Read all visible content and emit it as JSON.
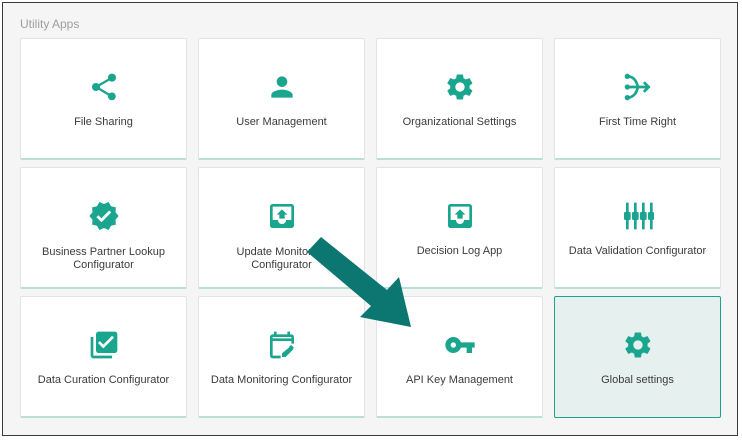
{
  "section": {
    "title": "Utility Apps"
  },
  "colors": {
    "accent": "#1aa58e",
    "arrow": "#0c7671",
    "selected_bg": "#e6f1ef"
  },
  "tiles": [
    {
      "label": "File Sharing",
      "icon": "share-icon"
    },
    {
      "label": "User Management",
      "icon": "person-icon"
    },
    {
      "label": "Organizational Settings",
      "icon": "gear-icon"
    },
    {
      "label": "First Time Right",
      "icon": "split-arrows-icon"
    },
    {
      "label": "Business Partner Lookup Configurator",
      "icon": "verified-badge-icon"
    },
    {
      "label": "Update Monitoring Configurator",
      "icon": "upload-tray-icon"
    },
    {
      "label": "Decision Log App",
      "icon": "upload-tray-icon"
    },
    {
      "label": "Data Validation Configurator",
      "icon": "sliders-icon"
    },
    {
      "label": "Data Curation Configurator",
      "icon": "checklist-stack-icon"
    },
    {
      "label": "Data Monitoring Configurator",
      "icon": "calendar-edit-icon"
    },
    {
      "label": "API Key Management",
      "icon": "key-icon"
    },
    {
      "label": "Global settings",
      "icon": "gear-icon",
      "selected": true
    }
  ]
}
